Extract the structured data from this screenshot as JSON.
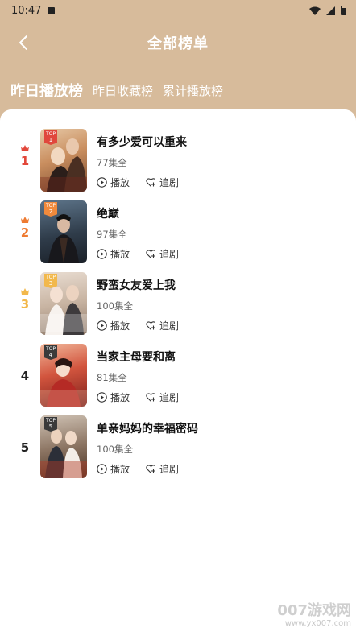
{
  "status_bar": {
    "time": "10:47"
  },
  "header": {
    "title": "全部榜单"
  },
  "tabs": [
    {
      "label": "昨日播放榜",
      "active": true
    },
    {
      "label": "昨日收藏榜",
      "active": false
    },
    {
      "label": "累计播放榜",
      "active": false
    }
  ],
  "actions": {
    "play_label": "播放",
    "follow_label": "追剧"
  },
  "items": [
    {
      "rank": "1",
      "title": "有多少爱可以重来",
      "episodes": "77集全",
      "badge_top": "TOP",
      "badge_num": "1",
      "rank_color": "#e2473a",
      "badge_color": "#e0473d"
    },
    {
      "rank": "2",
      "title": "绝巅",
      "episodes": "97集全",
      "badge_top": "TOP",
      "badge_num": "2",
      "rank_color": "#ee7b32",
      "badge_color": "#f08a3c"
    },
    {
      "rank": "3",
      "title": "野蛮女友爱上我",
      "episodes": "100集全",
      "badge_top": "TOP",
      "badge_num": "3",
      "rank_color": "#f2b84b",
      "badge_color": "#f2b84b"
    },
    {
      "rank": "4",
      "title": "当家主母要和离",
      "episodes": "81集全",
      "badge_top": "TOP",
      "badge_num": "4",
      "rank_color": "#222222",
      "badge_color": "#3a3a3a"
    },
    {
      "rank": "5",
      "title": "单亲妈妈的幸福密码",
      "episodes": "100集全",
      "badge_top": "TOP",
      "badge_num": "5",
      "rank_color": "#222222",
      "badge_color": "#3a3a3a"
    }
  ],
  "watermark": {
    "brand": "007游戏网",
    "url": "www.yx007.com"
  }
}
